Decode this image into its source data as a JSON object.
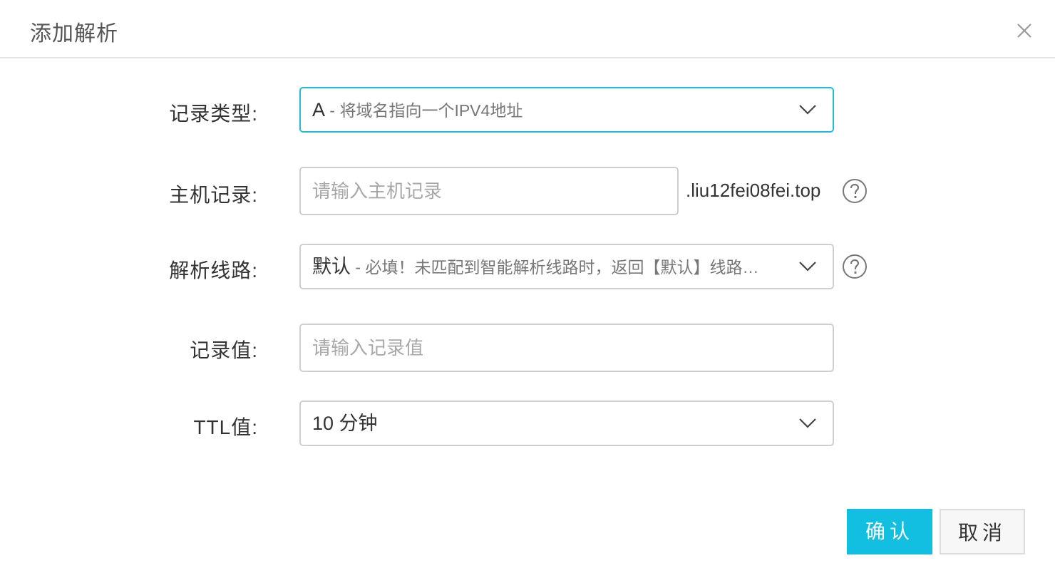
{
  "dialog": {
    "title": "添加解析",
    "close_icon": "close-icon"
  },
  "form": {
    "record_type": {
      "label": "记录类型:",
      "value": "A",
      "description": " - 将域名指向一个IPV4地址"
    },
    "host": {
      "label": "主机记录:",
      "placeholder": "请输入主机记录",
      "value": "",
      "suffix": ".liu12fei08fei.top",
      "help_icon": "question-circle-icon"
    },
    "line": {
      "label": "解析线路:",
      "value": "默认",
      "description": " - 必填！未匹配到智能解析线路时，返回【默认】线路…",
      "help_icon": "question-circle-icon"
    },
    "record_value": {
      "label": "记录值:",
      "placeholder": "请输入记录值",
      "value": ""
    },
    "ttl": {
      "label": "TTL值:",
      "value": "10 分钟"
    }
  },
  "buttons": {
    "confirm": "确认",
    "cancel": "取消"
  },
  "colors": {
    "accent": "#13bfe0",
    "focus_border": "#25b9d8",
    "border": "#cfcfcf",
    "divider": "#e5e5e5"
  }
}
